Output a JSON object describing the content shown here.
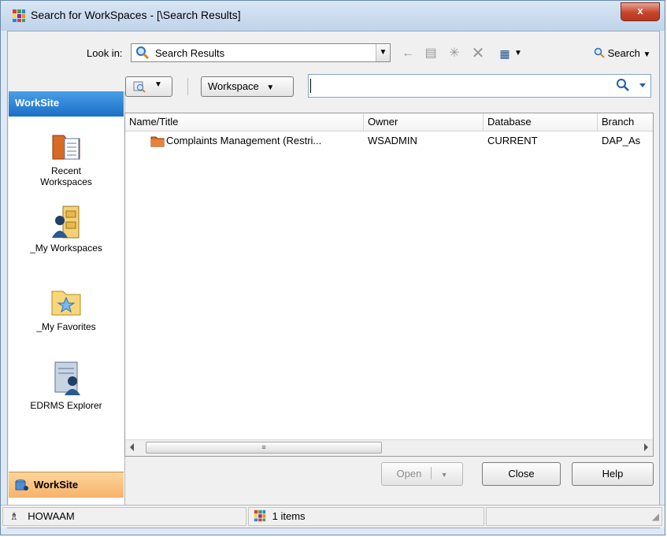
{
  "window": {
    "title": "Search for WorkSpaces - [\\Search Results]",
    "close_label": "x"
  },
  "toolbar": {
    "look_in_label": "Look in:",
    "look_in_value": "Search Results",
    "search_label": "Search"
  },
  "sidebar": {
    "header": "WorkSite",
    "items": [
      {
        "label": "Recent\nWorkspaces",
        "icon": "recent-workspaces-icon"
      },
      {
        "label": "_My Workspaces",
        "icon": "my-workspaces-icon"
      },
      {
        "label": "_My Favorites",
        "icon": "my-favorites-icon"
      },
      {
        "label": "EDRMS Explorer",
        "icon": "edrms-explorer-icon"
      }
    ],
    "footer": "WorkSite"
  },
  "search_bar": {
    "scope_button": "Workspace",
    "query_value": ""
  },
  "grid": {
    "columns": [
      "Name/Title",
      "Owner",
      "Database",
      "Branch"
    ],
    "rows": [
      {
        "name": "Complaints Management (Restri...",
        "owner": "WSADMIN",
        "database": "CURRENT",
        "branch": "DAP_As"
      }
    ]
  },
  "buttons": {
    "open": "Open",
    "close": "Close",
    "help": "Help"
  },
  "statusbar": {
    "user": "HOWAAM",
    "count": "1 items"
  },
  "colors": {
    "accent": "#1a6fc6",
    "sidebar_footer": "#f6b26b",
    "close_button": "#c7442b"
  }
}
